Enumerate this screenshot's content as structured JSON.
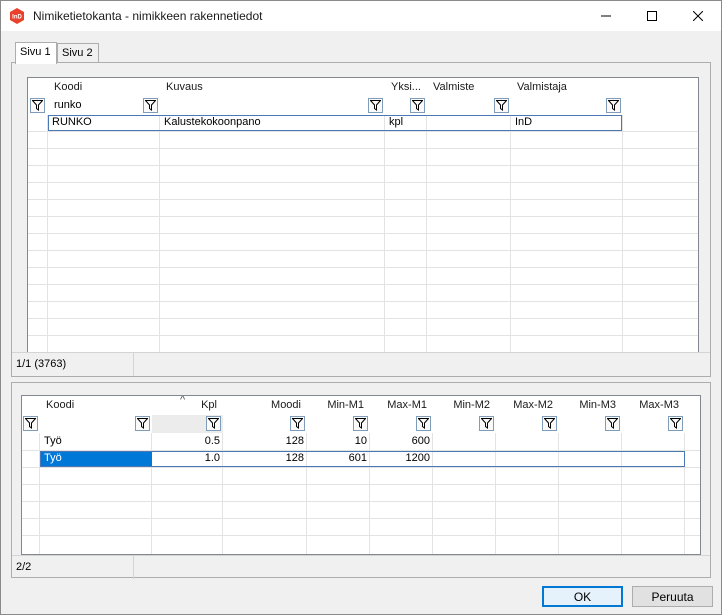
{
  "window": {
    "title": "Nimiketietokanta - nimikkeen rakennetiedot",
    "app_icon_text": "InD"
  },
  "tabs": [
    {
      "label": "Sivu 1"
    },
    {
      "label": "Sivu 2"
    }
  ],
  "upper_grid": {
    "headers": [
      "Koodi",
      "Kuvaus",
      "Yksi...",
      "Valmiste",
      "Valmistaja"
    ],
    "filters": {
      "koodi": "runko",
      "kuvaus": "",
      "yksikko": "",
      "valmiste": "",
      "valmistaja": ""
    },
    "rows": [
      {
        "koodi": "RUNKO",
        "kuvaus": "Kalustekokoonpano",
        "yksikko": "kpl",
        "valmiste": "",
        "valmistaja": "InD"
      }
    ],
    "status": "1/1 (3763)"
  },
  "lower_grid": {
    "headers": [
      "Koodi",
      "Kpl",
      "Moodi",
      "Min-M1",
      "Max-M1",
      "Min-M2",
      "Max-M2",
      "Min-M3",
      "Max-M3"
    ],
    "sort_indicator": "^",
    "rows": [
      {
        "koodi": "Työ",
        "kpl": "0.5",
        "moodi": "128",
        "min_m1": "10",
        "max_m1": "600",
        "min_m2": "",
        "max_m2": "",
        "min_m3": "",
        "max_m3": ""
      },
      {
        "koodi": "Työ",
        "kpl": "1.0",
        "moodi": "128",
        "min_m1": "601",
        "max_m1": "1200",
        "min_m2": "",
        "max_m2": "",
        "min_m3": "",
        "max_m3": ""
      }
    ],
    "status": "2/2"
  },
  "buttons": {
    "ok": "OK",
    "cancel": "Peruuta"
  },
  "colors": {
    "selection": "#0078d7",
    "app_icon": "#e8412c",
    "accent_border": "#0078d4"
  }
}
